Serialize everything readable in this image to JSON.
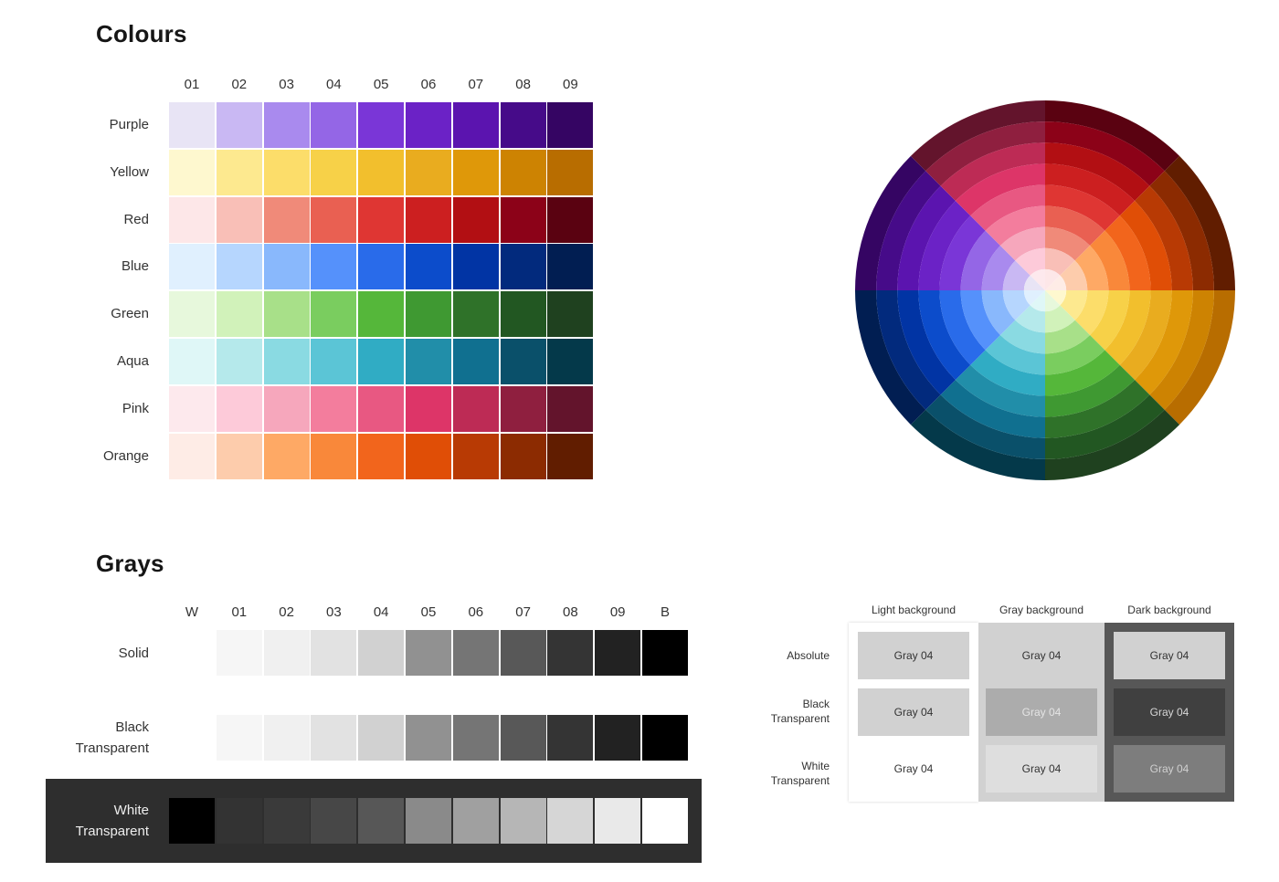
{
  "colours": {
    "title": "Colours",
    "columns": [
      "01",
      "02",
      "03",
      "04",
      "05",
      "06",
      "07",
      "08",
      "09"
    ],
    "rows": [
      {
        "name": "Purple",
        "swatches": [
          "#e8e4f5",
          "#c9b8f3",
          "#a98aee",
          "#9466e6",
          "#7a36d7",
          "#6b22c6",
          "#5b14af",
          "#460b89",
          "#350563"
        ]
      },
      {
        "name": "Yellow",
        "swatches": [
          "#fef8cf",
          "#fde98f",
          "#fcdd6a",
          "#f7d148",
          "#f2bf2d",
          "#e9ac1f",
          "#df9809",
          "#cd8302",
          "#b86d00"
        ]
      },
      {
        "name": "Red",
        "swatches": [
          "#fde7e8",
          "#f9bfb7",
          "#f08a79",
          "#e96052",
          "#df3633",
          "#cc1f20",
          "#b20f13",
          "#8c0218",
          "#5a0211"
        ]
      },
      {
        "name": "Blue",
        "swatches": [
          "#e0f0fe",
          "#b6d6fe",
          "#89b8fc",
          "#5591fb",
          "#296bea",
          "#0c4ccb",
          "#0134a4",
          "#022a7d",
          "#011e52"
        ]
      },
      {
        "name": "Green",
        "swatches": [
          "#e7f8dc",
          "#d1f2ba",
          "#a8e089",
          "#7acd5f",
          "#55b73a",
          "#3f9932",
          "#2f7229",
          "#225722",
          "#1f411f"
        ]
      },
      {
        "name": "Aqua",
        "swatches": [
          "#dff7f7",
          "#b5e9eb",
          "#8adae2",
          "#5bc5d6",
          "#30acc4",
          "#218ea9",
          "#107090",
          "#0a506a",
          "#04394a"
        ]
      },
      {
        "name": "Pink",
        "swatches": [
          "#fde9ed",
          "#fdcad9",
          "#f6a7bc",
          "#f37d9d",
          "#e85882",
          "#dd3568",
          "#bd2b55",
          "#8f1f3f",
          "#63142c"
        ]
      },
      {
        "name": "Orange",
        "swatches": [
          "#feece6",
          "#fdccac",
          "#fea965",
          "#f9883a",
          "#f2651c",
          "#e04e06",
          "#b83a04",
          "#8c2b01",
          "#611d00"
        ]
      }
    ]
  },
  "wheel": {
    "sectors": [
      {
        "name": "Red",
        "swatches": [
          "#fde7e8",
          "#f9bfb7",
          "#f08a79",
          "#e96052",
          "#df3633",
          "#cc1f20",
          "#b20f13",
          "#8c0218",
          "#5a0211"
        ]
      },
      {
        "name": "Orange",
        "swatches": [
          "#feece6",
          "#fdccac",
          "#fea965",
          "#f9883a",
          "#f2651c",
          "#e04e06",
          "#b83a04",
          "#8c2b01",
          "#611d00"
        ]
      },
      {
        "name": "Yellow",
        "swatches": [
          "#fef8cf",
          "#fde98f",
          "#fcdd6a",
          "#f7d148",
          "#f2bf2d",
          "#e9ac1f",
          "#df9809",
          "#cd8302",
          "#b86d00"
        ]
      },
      {
        "name": "Green",
        "swatches": [
          "#e7f8dc",
          "#d1f2ba",
          "#a8e089",
          "#7acd5f",
          "#55b73a",
          "#3f9932",
          "#2f7229",
          "#225722",
          "#1f411f"
        ]
      },
      {
        "name": "Aqua",
        "swatches": [
          "#dff7f7",
          "#b5e9eb",
          "#8adae2",
          "#5bc5d6",
          "#30acc4",
          "#218ea9",
          "#107090",
          "#0a506a",
          "#04394a"
        ]
      },
      {
        "name": "Blue",
        "swatches": [
          "#e0f0fe",
          "#b6d6fe",
          "#89b8fc",
          "#5591fb",
          "#296bea",
          "#0c4ccb",
          "#0134a4",
          "#022a7d",
          "#011e52"
        ]
      },
      {
        "name": "Purple",
        "swatches": [
          "#e8e4f5",
          "#c9b8f3",
          "#a98aee",
          "#9466e6",
          "#7a36d7",
          "#6b22c6",
          "#5b14af",
          "#460b89",
          "#350563"
        ]
      },
      {
        "name": "Pink",
        "swatches": [
          "#fde9ed",
          "#fdcad9",
          "#f6a7bc",
          "#f37d9d",
          "#e85882",
          "#dd3568",
          "#bd2b55",
          "#8f1f3f",
          "#63142c"
        ]
      }
    ]
  },
  "grays": {
    "title": "Grays",
    "columns": [
      "W",
      "01",
      "02",
      "03",
      "04",
      "05",
      "06",
      "07",
      "08",
      "09",
      "B"
    ],
    "solid": {
      "label": "Solid",
      "swatches": [
        "#ffffff",
        "#f6f6f6",
        "#f0f0f0",
        "#e2e2e2",
        "#d1d1d1",
        "#919191",
        "#757575",
        "#585858",
        "#343434",
        "#222222",
        "#000000"
      ]
    },
    "black_transparent": {
      "label_line1": "Black",
      "label_line2": "Transparent",
      "swatches": [
        "#ffffff",
        "#f6f6f6",
        "#f0f0f0",
        "#e2e2e2",
        "#d1d1d1",
        "#919191",
        "#757575",
        "#585858",
        "#343434",
        "#222222",
        "#000000"
      ]
    },
    "white_transparent": {
      "label_line1": "White",
      "label_line2": "Transparent",
      "swatches": [
        "#000000",
        "#333333",
        "#3a3a3a",
        "#474747",
        "#575757",
        "#8a8a8a",
        "#a0a0a0",
        "#b6b6b6",
        "#d6d6d6",
        "#e9e9e9",
        "#ffffff"
      ]
    }
  },
  "backgrounds": {
    "headers": [
      "Light background",
      "Gray background",
      "Dark background"
    ],
    "column_colors": [
      "#ffffff",
      "#d1d1d1",
      "#575757"
    ],
    "rows": [
      {
        "label_line1": "Absolute",
        "label_line2": ""
      },
      {
        "label_line1": "Black",
        "label_line2": "Transparent"
      },
      {
        "label_line1": "White",
        "label_line2": "Transparent"
      }
    ],
    "cells": [
      [
        {
          "text": "Gray 04",
          "bg": "#d1d1d1",
          "fg": "#333333"
        },
        {
          "text": "Gray 04",
          "bg": "#d1d1d1",
          "fg": "#333333"
        },
        {
          "text": "Gray 04",
          "bg": "#d1d1d1",
          "fg": "#333333"
        }
      ],
      [
        {
          "text": "Gray 04",
          "bg": "#d1d1d1",
          "fg": "#333333"
        },
        {
          "text": "Gray 04",
          "bg": "#acacac",
          "fg": "#e4e4e4"
        },
        {
          "text": "Gray 04",
          "bg": "#404040",
          "fg": "#d6d6d6"
        }
      ],
      [
        {
          "text": "Gray 04",
          "bg": "#ffffff",
          "fg": "#333333"
        },
        {
          "text": "Gray 04",
          "bg": "#dedede",
          "fg": "#333333"
        },
        {
          "text": "Gray 04",
          "bg": "#7d7d7d",
          "fg": "#d0d0d0"
        }
      ]
    ]
  }
}
